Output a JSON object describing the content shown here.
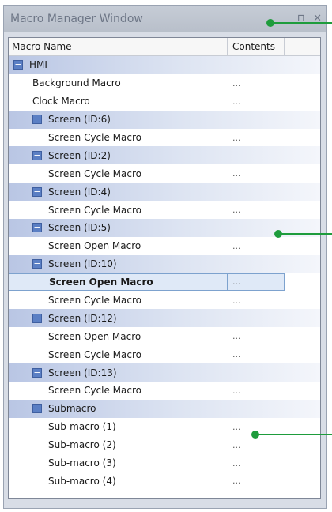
{
  "window": {
    "title": "Macro Manager Window",
    "pin_glyph": "⊓",
    "close_glyph": "✕"
  },
  "table": {
    "col_name": "Macro Name",
    "col_contents": "Contents",
    "rows": [
      {
        "label": "HMI",
        "type": "group",
        "level": 0,
        "contents": ""
      },
      {
        "label": "Background Macro",
        "type": "leaf",
        "level": 1,
        "contents": "..."
      },
      {
        "label": "Clock Macro",
        "type": "leaf",
        "level": 1,
        "contents": "..."
      },
      {
        "label": "Screen (ID:6)",
        "type": "group",
        "level": 1,
        "contents": ""
      },
      {
        "label": "Screen Cycle Macro",
        "type": "leaf",
        "level": 2,
        "contents": "..."
      },
      {
        "label": "Screen (ID:2)",
        "type": "group",
        "level": 1,
        "contents": ""
      },
      {
        "label": "Screen Cycle Macro",
        "type": "leaf",
        "level": 2,
        "contents": "..."
      },
      {
        "label": "Screen (ID:4)",
        "type": "group",
        "level": 1,
        "contents": ""
      },
      {
        "label": "Screen Cycle Macro",
        "type": "leaf",
        "level": 2,
        "contents": "..."
      },
      {
        "label": "Screen (ID:5)",
        "type": "group",
        "level": 1,
        "contents": ""
      },
      {
        "label": "Screen Open Macro",
        "type": "leaf",
        "level": 2,
        "contents": "..."
      },
      {
        "label": "Screen (ID:10)",
        "type": "group",
        "level": 1,
        "contents": ""
      },
      {
        "label": "Screen Open Macro",
        "type": "leaf",
        "level": 2,
        "contents": "...",
        "selected": true
      },
      {
        "label": "Screen Cycle Macro",
        "type": "leaf",
        "level": 2,
        "contents": "..."
      },
      {
        "label": "Screen (ID:12)",
        "type": "group",
        "level": 1,
        "contents": ""
      },
      {
        "label": "Screen Open Macro",
        "type": "leaf",
        "level": 2,
        "contents": "..."
      },
      {
        "label": "Screen Cycle Macro",
        "type": "leaf",
        "level": 2,
        "contents": "..."
      },
      {
        "label": "Screen (ID:13)",
        "type": "group",
        "level": 1,
        "contents": ""
      },
      {
        "label": "Screen Cycle Macro",
        "type": "leaf",
        "level": 2,
        "contents": "..."
      },
      {
        "label": "Submacro",
        "type": "group",
        "level": 1,
        "contents": ""
      },
      {
        "label": "Sub-macro (1)",
        "type": "leaf",
        "level": 2,
        "contents": "..."
      },
      {
        "label": "Sub-macro (2)",
        "type": "leaf",
        "level": 2,
        "contents": "..."
      },
      {
        "label": "Sub-macro (3)",
        "type": "leaf",
        "level": 2,
        "contents": "..."
      },
      {
        "label": "Sub-macro (4)",
        "type": "leaf",
        "level": 2,
        "contents": "..."
      }
    ]
  },
  "colors": {
    "callout": "#1e9c3c",
    "group_row": "#b9c6e4",
    "expand_box": "#5b7fc4"
  }
}
